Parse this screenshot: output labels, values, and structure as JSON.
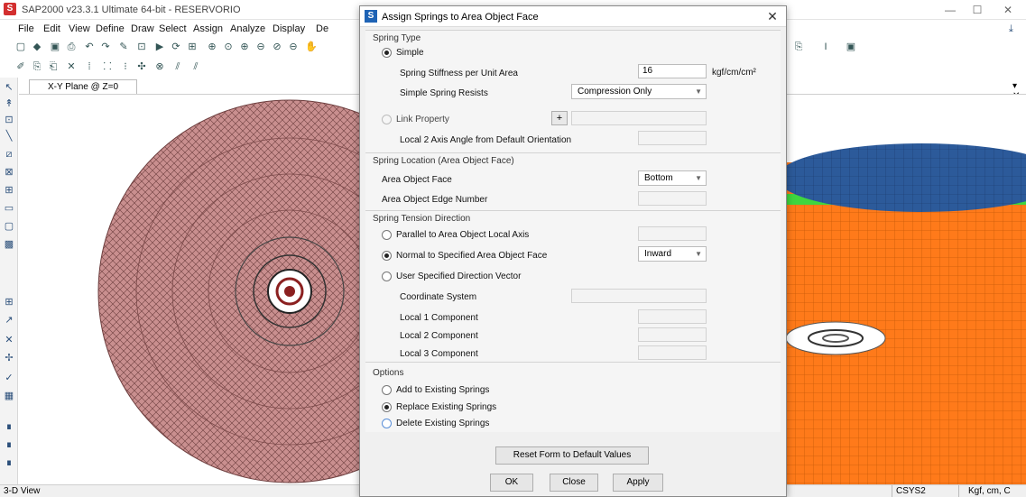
{
  "app": {
    "title": "SAP2000 v23.3.1 Ultimate 64-bit - RESERVORIO",
    "icon": "sap-logo-icon",
    "menu": [
      "File",
      "Edit",
      "View",
      "Define",
      "Draw",
      "Select",
      "Assign",
      "Analyze",
      "Display",
      "De"
    ],
    "window_controls": [
      "—",
      "☐",
      "✕"
    ]
  },
  "viewport": {
    "tab_label": "X-Y Plane @ Z=0",
    "status_left": "3-D View",
    "coord_system": "CSYS2",
    "units": "Kgf, cm, C",
    "colors": {
      "plan_fill": "#c98f8f",
      "plan_stroke": "#6e3f3f",
      "tank_top": "#2c5a9a",
      "tank_band": "#3fd63f",
      "tank_wall": "#ff7a1a"
    }
  },
  "dialog": {
    "title": "Assign Springs to Area Object Face",
    "close": "✕",
    "spring_type": {
      "label": "Spring Type",
      "simple_label": "Simple",
      "simple_selected": true,
      "stiffness_label": "Spring Stiffness per Unit Area",
      "stiffness_value": "16",
      "stiffness_unit": "kgf/cm/cm²",
      "resists_label": "Simple Spring Resists",
      "resists_value": "Compression Only",
      "link_label": "Link Property",
      "link_button": "+",
      "local2_angle_label": "Local 2 Axis Angle from Default Orientation"
    },
    "location": {
      "label": "Spring Location (Area Object Face)",
      "face_label": "Area Object Face",
      "face_value": "Bottom",
      "edge_label": "Area Object Edge Number"
    },
    "tension": {
      "label": "Spring Tension Direction",
      "parallel_label": "Parallel to Area Object Local Axis",
      "normal_label": "Normal to Specified Area Object Face",
      "normal_value": "Inward",
      "user_label": "User Specified Direction Vector",
      "coord_label": "Coordinate System",
      "local1_label": "Local 1 Component",
      "local2_label": "Local 2 Component",
      "local3_label": "Local 3 Component"
    },
    "options": {
      "label": "Options",
      "add_label": "Add to Existing Springs",
      "replace_label": "Replace Existing Springs",
      "delete_label": "Delete Existing Springs"
    },
    "buttons": {
      "reset": "Reset Form to Default Values",
      "ok": "OK",
      "close": "Close",
      "apply": "Apply"
    }
  }
}
